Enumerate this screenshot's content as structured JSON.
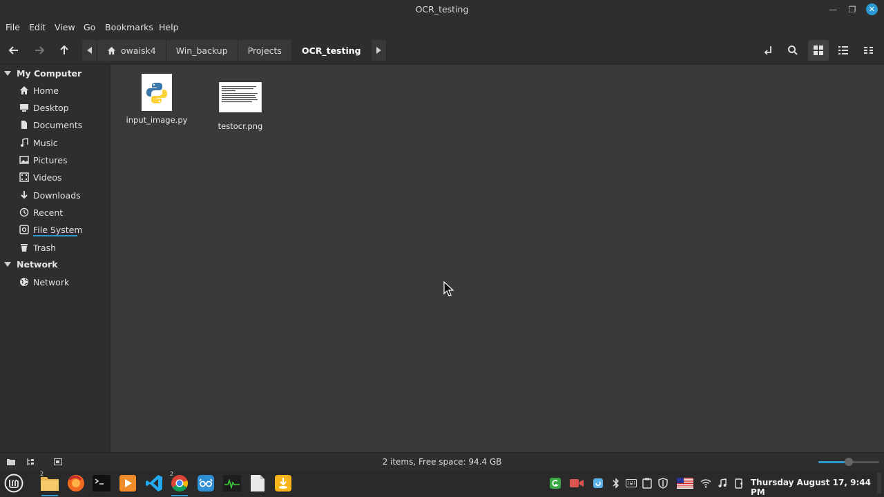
{
  "window": {
    "title": "OCR_testing"
  },
  "menu": [
    "File",
    "Edit",
    "View",
    "Go",
    "Bookmarks",
    "Help"
  ],
  "breadcrumbs": [
    "owaisk4",
    "Win_backup",
    "Projects",
    "OCR_testing"
  ],
  "sidebar": {
    "my_computer": "My Computer",
    "items": [
      "Home",
      "Desktop",
      "Documents",
      "Music",
      "Pictures",
      "Videos",
      "Downloads",
      "Recent",
      "File System",
      "Trash"
    ],
    "network_head": "Network",
    "network_items": [
      "Network"
    ]
  },
  "files": [
    {
      "name": "input_image.py",
      "type": "python"
    },
    {
      "name": "testocr.png",
      "type": "image"
    }
  ],
  "status": {
    "text": "2 items, Free space: 94.4 GB",
    "zoom_fraction": 0.5
  },
  "taskbar": {
    "badge_files": "2",
    "badge_chrome": "2",
    "clock": "Thursday August 17, 9:44 PM"
  },
  "colors": {
    "accent": "#2b9ad4",
    "content_bg": "#3a3a3a",
    "panel_bg": "#2e2e2e"
  }
}
